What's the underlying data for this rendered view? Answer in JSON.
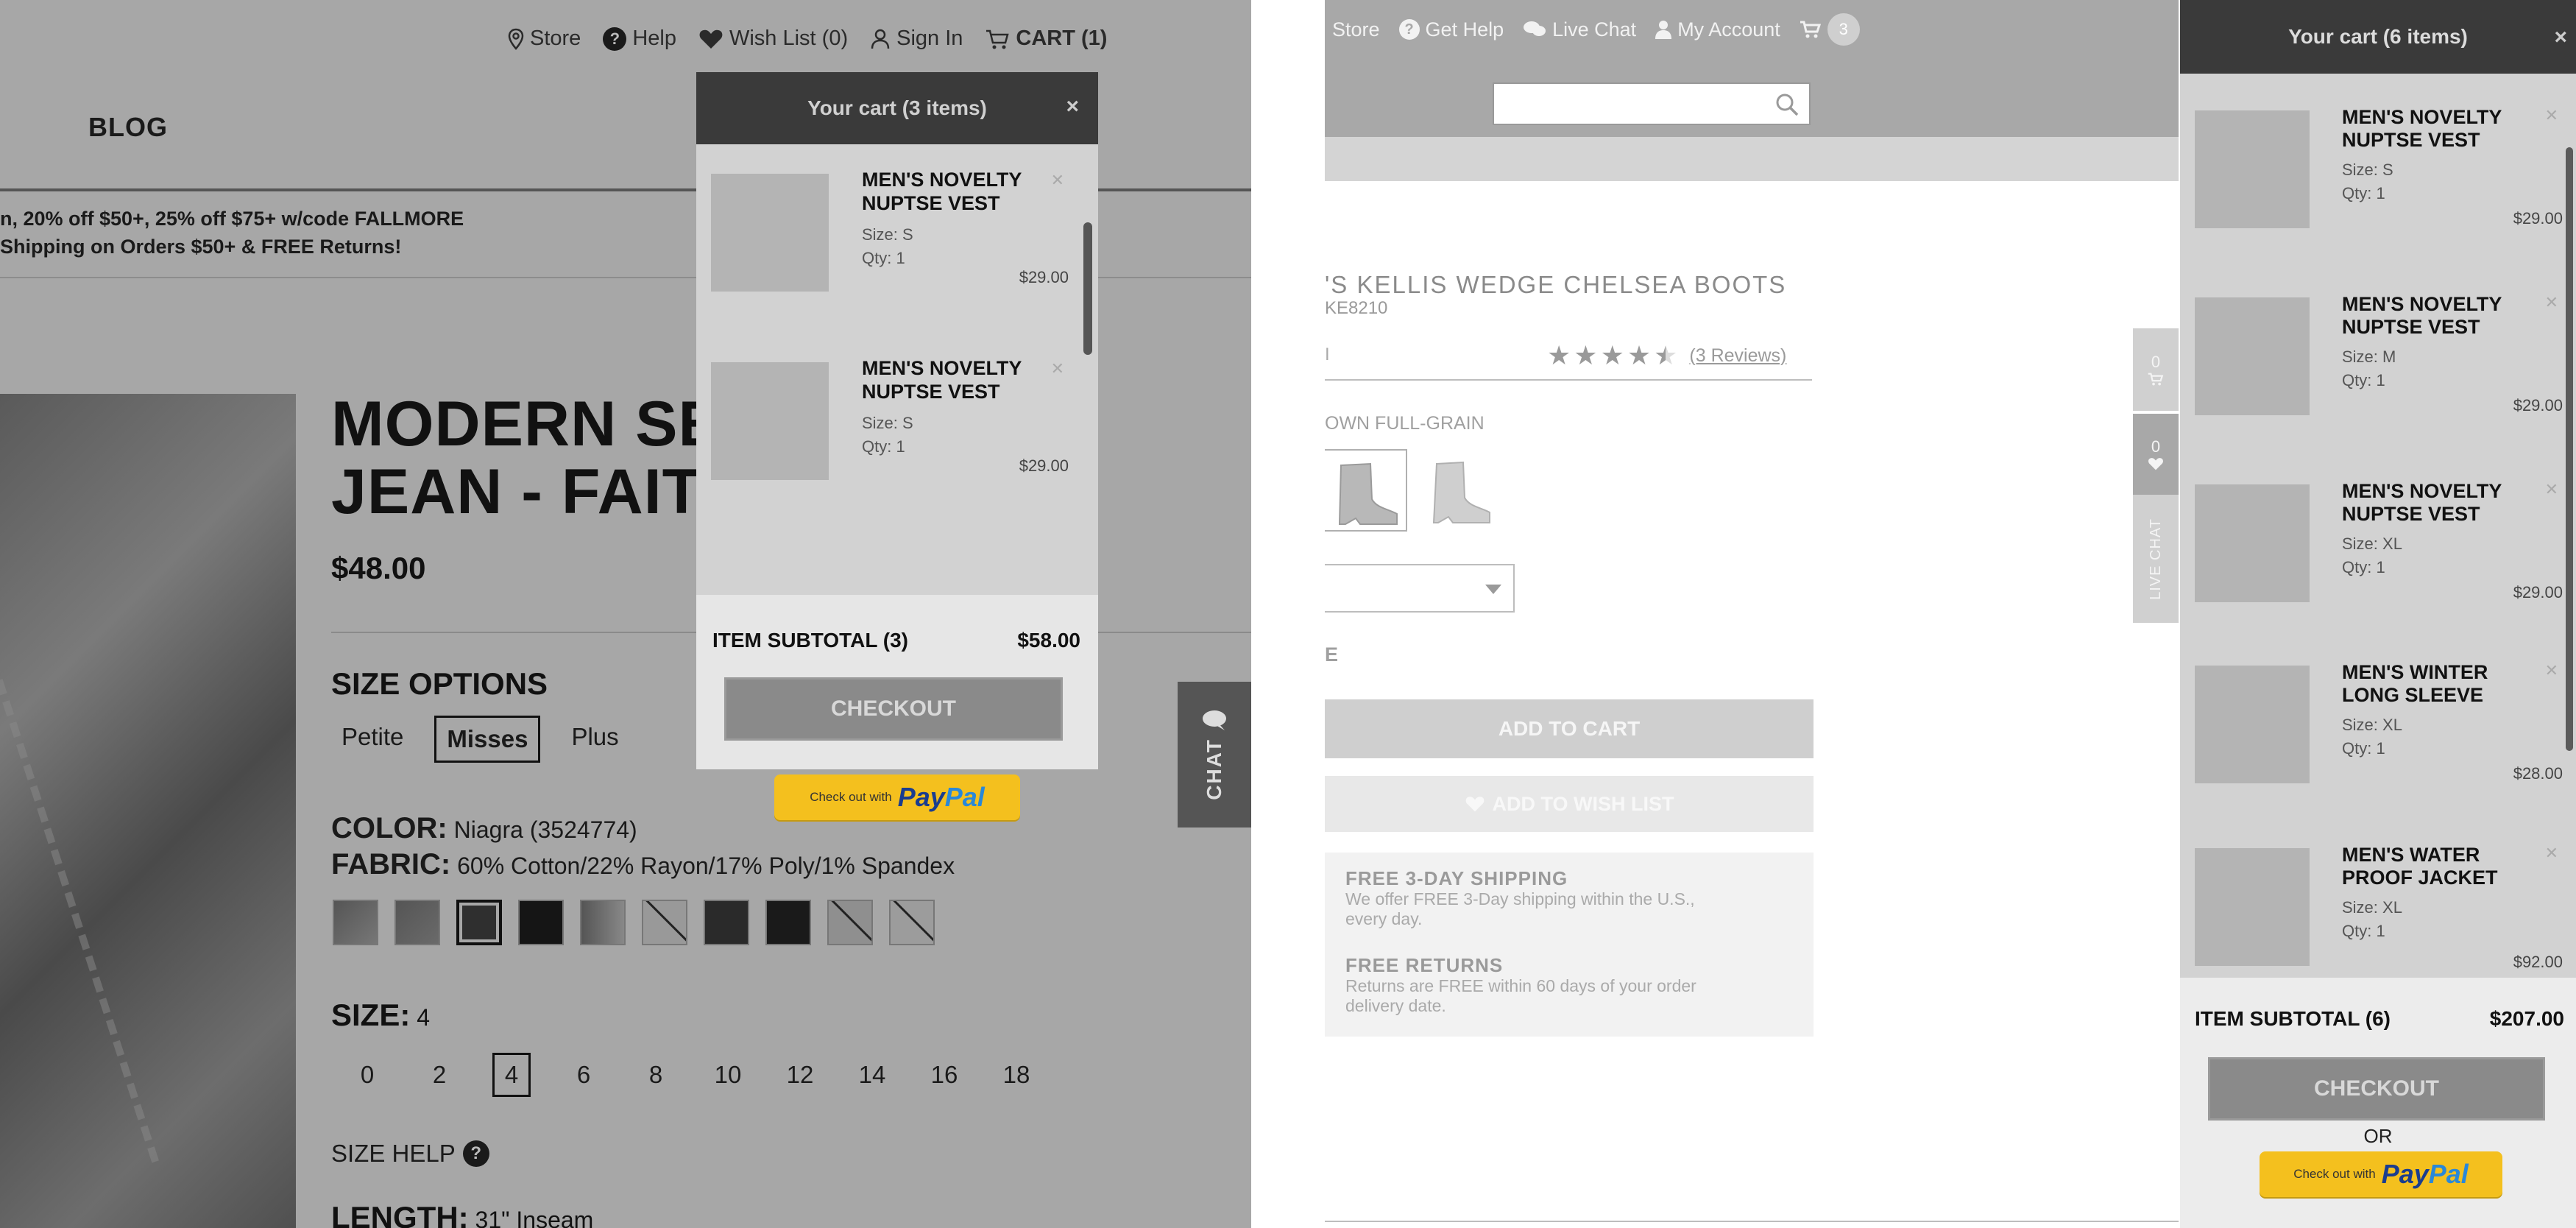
{
  "left": {
    "topnav": {
      "store": "Store",
      "help": "Help",
      "wishlist": "Wish List (0)",
      "signin": "Sign In",
      "cart": "CART (1)"
    },
    "blog": "BLOG",
    "promo_line1": "n, 20% off $50+, 25% off $75+ w/code FALLMORE",
    "promo_line2": "Shipping on Orders $50+ & FREE Returns!",
    "product": {
      "title_line1": "MODERN SER",
      "title_line2": "JEAN - FAITH",
      "price": "$48.00",
      "size_options_label": "SIZE OPTIONS",
      "fits": [
        "Petite",
        "Misses",
        "Plus"
      ],
      "selected_fit": "Misses",
      "color_label": "COLOR:",
      "color_value": "Niagra (3524774)",
      "fabric_label": "FABRIC:",
      "fabric_value": "60% Cotton/22% Rayon/17% Poly/1% Spandex",
      "size_label": "SIZE:",
      "size_value": "4",
      "sizes": [
        "0",
        "2",
        "4",
        "6",
        "8",
        "10",
        "12",
        "14",
        "16",
        "18"
      ],
      "selected_size": "4",
      "size_help": "SIZE HELP",
      "length_label": "LENGTH:",
      "length_value": "31\" Inseam"
    },
    "chat_tab": "CHAT",
    "cart": {
      "header": "Your cart (3 items)",
      "items": [
        {
          "name": "MEN'S NOVELTY NUPTSE VEST",
          "size": "Size: S",
          "qty": "Qty: 1",
          "price": "$29.00"
        },
        {
          "name": "MEN'S NOVELTY NUPTSE VEST",
          "size": "Size: S",
          "qty": "Qty: 1",
          "price": "$29.00"
        }
      ],
      "subtotal_label": "ITEM SUBTOTAL (3)",
      "subtotal_value": "$58.00",
      "checkout": "CHECKOUT",
      "paypal_prefix": "Check out with",
      "paypal_brand_a": "Pay",
      "paypal_brand_b": "Pal"
    }
  },
  "right": {
    "topnav": {
      "store": "Store",
      "help": "Get Help",
      "chat": "Live Chat",
      "account": "My Account",
      "cart_count": "3"
    },
    "product": {
      "title": "'S KELLIS WEDGE CHELSEA BOOTS",
      "sku": "KE8210",
      "cut_char": "I",
      "reviews": "(3 Reviews)",
      "color_name": "OWN FULL-GRAIN",
      "size_partial": "E",
      "add_to_cart": "ADD TO CART",
      "add_to_wishlist": "ADD TO WISH LIST",
      "shipping_title": "FREE 3-DAY SHIPPING",
      "shipping_text": "We offer FREE 3-Day shipping within the U.S., every day.",
      "returns_title": "FREE RETURNS",
      "returns_text": "Returns are FREE within 60 days of your order delivery date."
    },
    "side_tabs": {
      "cart_count": "0",
      "wish_count": "0",
      "chat": "LIVE CHAT"
    },
    "cart": {
      "header": "Your cart (6 items)",
      "items": [
        {
          "name": "MEN'S NOVELTY NUPTSE VEST",
          "size": "Size: S",
          "qty": "Qty: 1",
          "price": "$29.00"
        },
        {
          "name": "MEN'S NOVELTY NUPTSE VEST",
          "size": "Size: M",
          "qty": "Qty: 1",
          "price": "$29.00"
        },
        {
          "name": "MEN'S NOVELTY NUPTSE VEST",
          "size": "Size: XL",
          "qty": "Qty: 1",
          "price": "$29.00"
        },
        {
          "name": "MEN'S WINTER LONG SLEEVE",
          "size": "Size: XL",
          "qty": "Qty: 1",
          "price": "$28.00"
        },
        {
          "name": "MEN'S WATER PROOF JACKET",
          "size": "Size: XL",
          "qty": "Qty: 1",
          "price": "$92.00"
        }
      ],
      "subtotal_label": "ITEM SUBTOTAL (6)",
      "subtotal_value": "$207.00",
      "checkout": "CHECKOUT",
      "or": "OR",
      "paypal_prefix": "Check out with",
      "paypal_brand_a": "Pay",
      "paypal_brand_b": "Pal"
    }
  }
}
